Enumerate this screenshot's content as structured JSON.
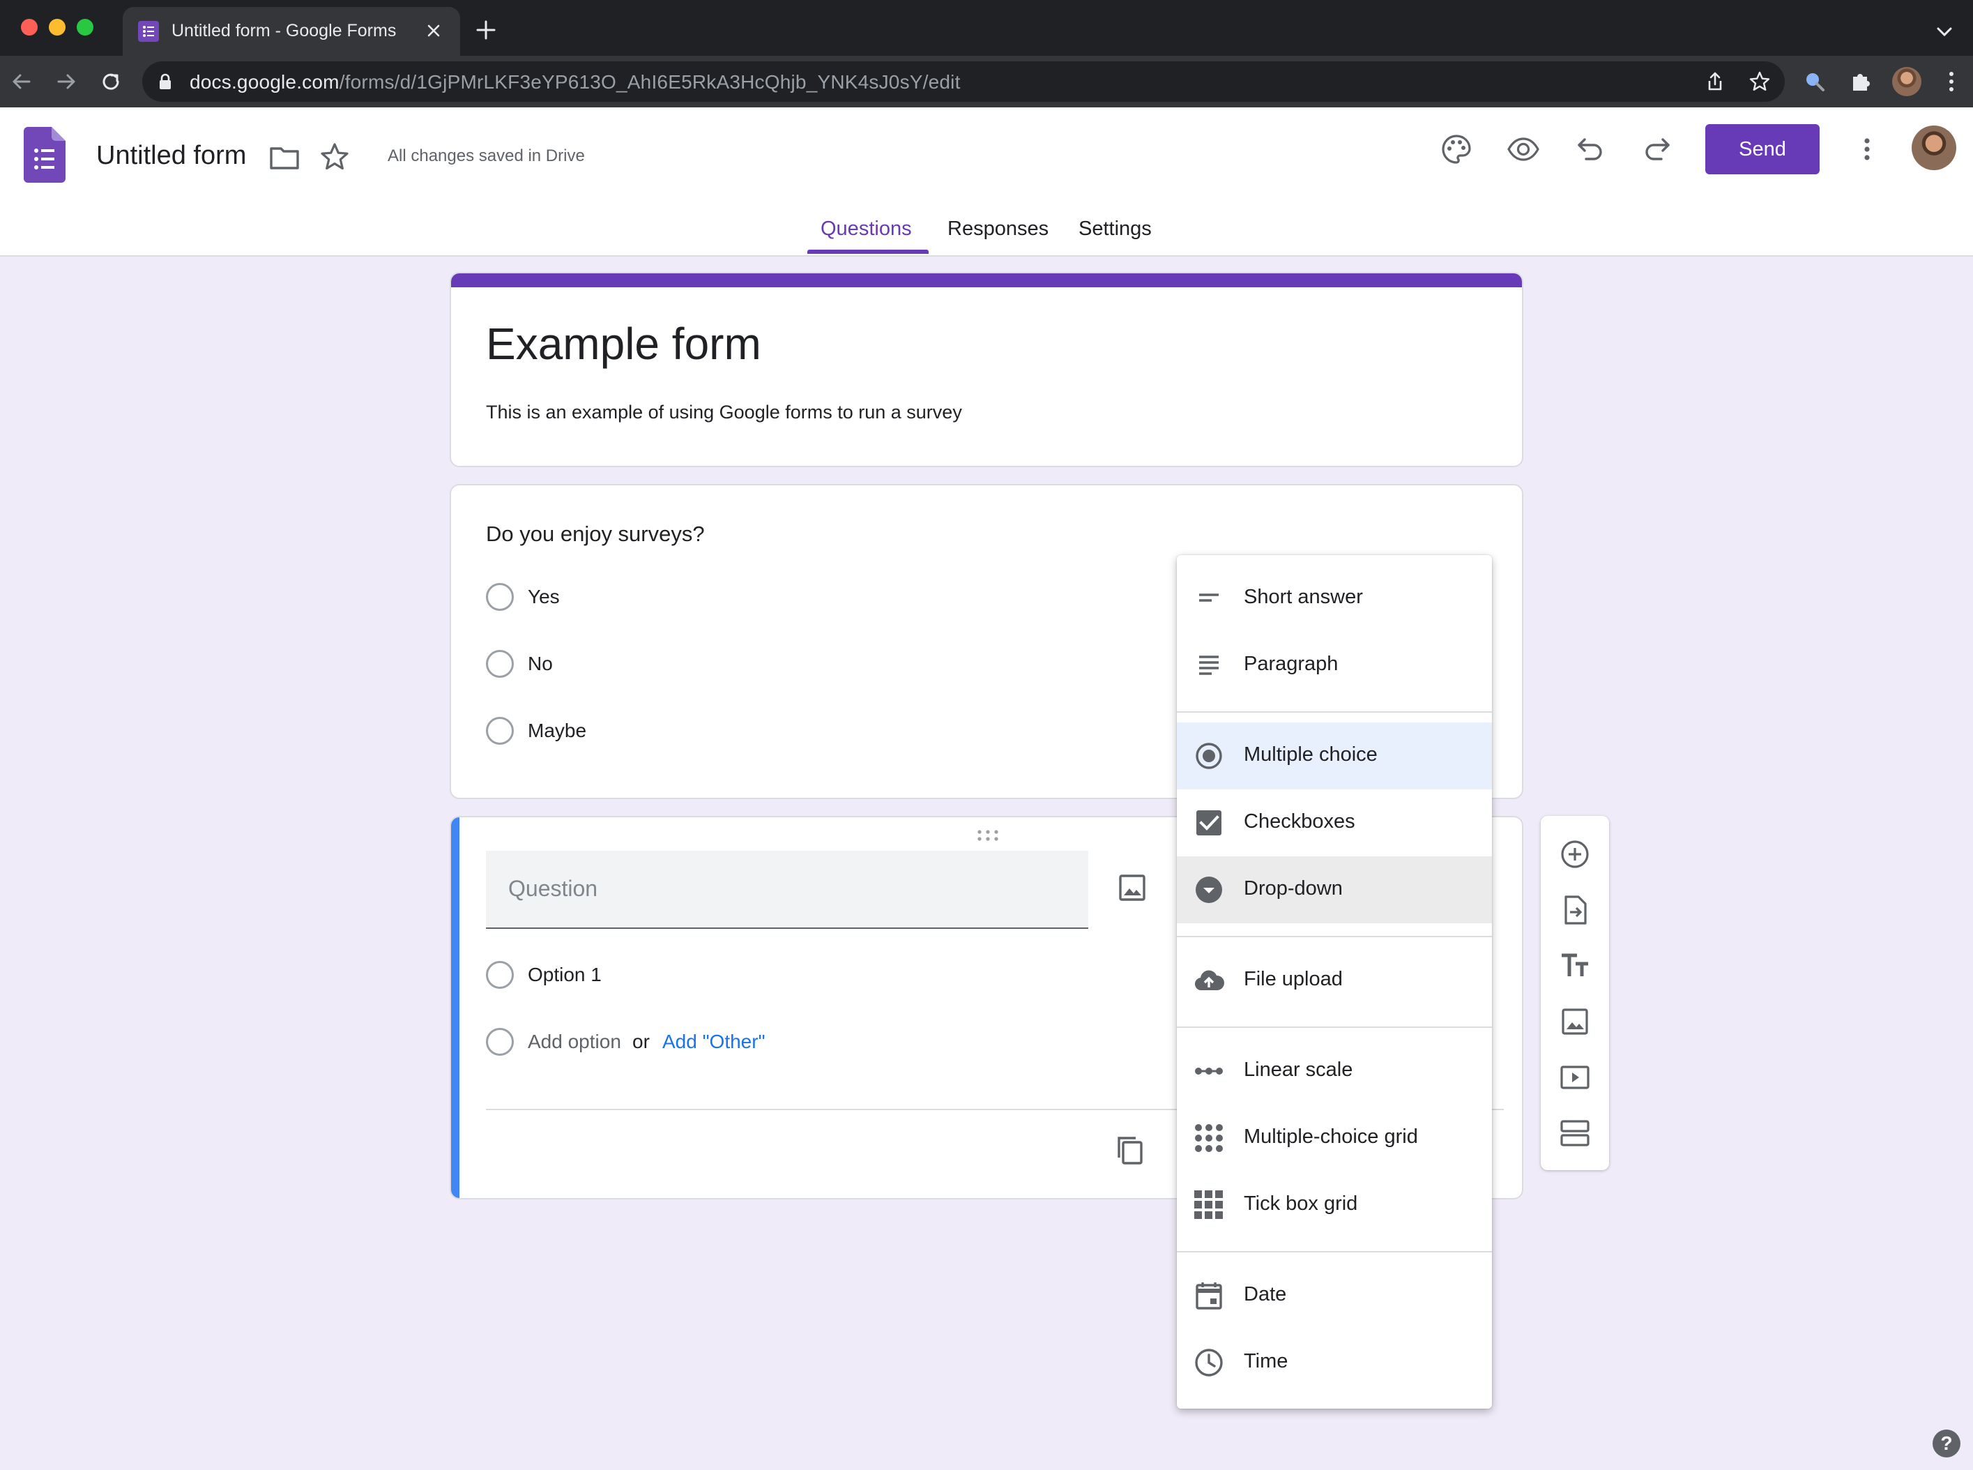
{
  "browser": {
    "tab_title": "Untitled form - Google Forms",
    "url_host": "docs.google.com",
    "url_path": "/forms/d/1GjPMrLKF3eYP613O_AhI6E5RkA3HcQhjb_YNK4sJ0sY/edit",
    "traffic_colors": [
      "#ff5f57",
      "#febc2e",
      "#28c840"
    ]
  },
  "header": {
    "doc_title": "Untitled form",
    "save_status": "All changes saved in Drive",
    "send_label": "Send",
    "accent": "#673ab7"
  },
  "tabs": [
    {
      "label": "Questions",
      "active": true
    },
    {
      "label": "Responses",
      "active": false
    },
    {
      "label": "Settings",
      "active": false
    }
  ],
  "form": {
    "heading": "Example form",
    "description": "This is an example of using Google forms to run a survey"
  },
  "question1": {
    "text": "Do you enjoy surveys?",
    "options": [
      "Yes",
      "No",
      "Maybe"
    ]
  },
  "question2": {
    "placeholder": "Question",
    "option1": "Option 1",
    "add_option": "Add option",
    "or": "or",
    "add_other": "Add \"Other\""
  },
  "type_menu": {
    "items": [
      {
        "label": "Short answer",
        "icon": "short-answer-icon"
      },
      {
        "label": "Paragraph",
        "icon": "paragraph-icon"
      },
      {
        "label": "Multiple choice",
        "icon": "radio-button-icon",
        "selected": true
      },
      {
        "label": "Checkboxes",
        "icon": "checkbox-icon"
      },
      {
        "label": "Drop-down",
        "icon": "dropdown-icon",
        "hovered": true
      },
      {
        "label": "File upload",
        "icon": "cloud-upload-icon"
      },
      {
        "label": "Linear scale",
        "icon": "linear-scale-icon"
      },
      {
        "label": "Multiple-choice grid",
        "icon": "grid-dots-icon"
      },
      {
        "label": "Tick box grid",
        "icon": "grid-squares-icon"
      },
      {
        "label": "Date",
        "icon": "calendar-icon"
      },
      {
        "label": "Time",
        "icon": "clock-icon"
      }
    ]
  },
  "side_toolbar": [
    "add-question-icon",
    "import-questions-icon",
    "add-title-icon",
    "add-image-icon",
    "add-video-icon",
    "add-section-icon"
  ],
  "help_label": "?"
}
